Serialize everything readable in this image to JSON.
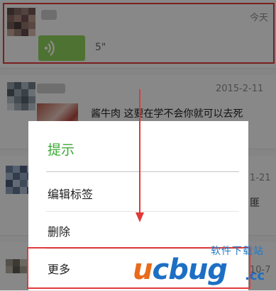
{
  "feed": {
    "items": [
      {
        "date": "今天",
        "voice_duration": "5\""
      },
      {
        "date": "2015-2-11",
        "snippet": "酱牛肉 这要在学不会你就可以去死"
      },
      {
        "date_partial": "1-21",
        "partial_text": "匪"
      },
      {
        "date_partial": "10-7"
      }
    ]
  },
  "dialog": {
    "title": "提示",
    "items": [
      {
        "label": "编辑标签"
      },
      {
        "label": "删除"
      },
      {
        "label": "更多"
      }
    ]
  },
  "watermark": {
    "top_text": "软件下载站",
    "logo_u": "u",
    "logo_rest": "cbug",
    "logo_suffix": ".cc"
  },
  "colors": {
    "accent_green": "#3ba936",
    "highlight_red": "#e13a3a",
    "voice_bubble": "#8fcf5a",
    "watermark_blue": "#1d6fc4",
    "watermark_orange": "#e96b1c"
  },
  "icons": {
    "voice": "voice-wave-icon",
    "arrow": "arrow-down-icon"
  }
}
